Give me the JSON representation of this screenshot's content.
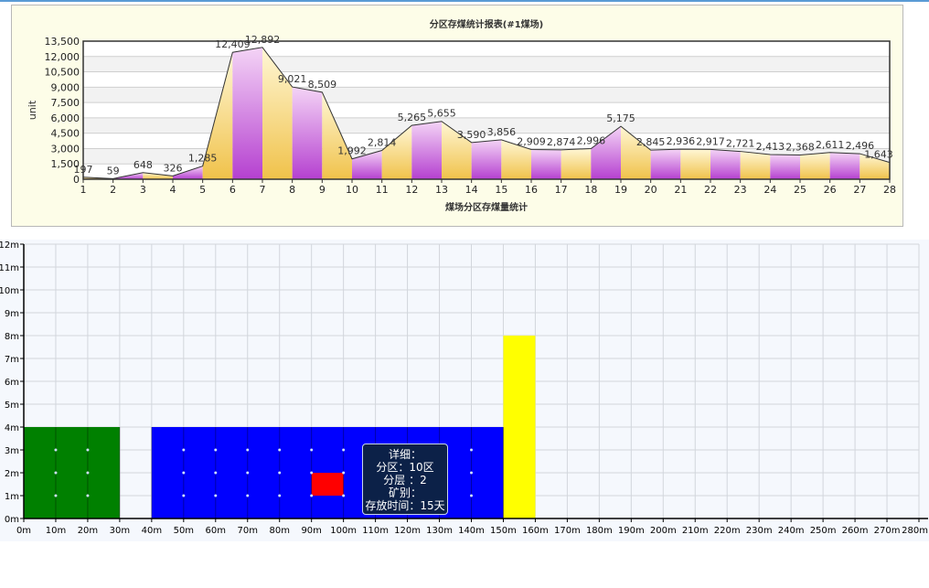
{
  "chart_data": [
    {
      "type": "area",
      "title": "分区存煤统计报表(#1煤场)",
      "xlabel": "煤场分区存煤量统计",
      "ylabel": "unit",
      "categories": [
        "1",
        "2",
        "3",
        "4",
        "5",
        "6",
        "7",
        "8",
        "9",
        "10",
        "11",
        "12",
        "13",
        "14",
        "15",
        "16",
        "17",
        "18",
        "19",
        "20",
        "21",
        "22",
        "23",
        "24",
        "25",
        "26",
        "27",
        "28"
      ],
      "values": [
        197,
        59,
        648,
        326,
        1285,
        12409,
        12892,
        9021,
        8509,
        1992,
        2814,
        5265,
        5655,
        3590,
        3856,
        2909,
        2874,
        2996,
        5175,
        2845,
        2936,
        2917,
        2721,
        2413,
        2368,
        2611,
        2496,
        1643
      ],
      "value_labels": [
        "197",
        "59",
        "648",
        "326",
        "1,285",
        "12,409",
        "12,892",
        "9,021",
        "8,509",
        "1,992",
        "2,814",
        "5,265",
        "5,655",
        "3,590",
        "3,856",
        "2,909",
        "2,874",
        "2,996",
        "5,175",
        "2,845",
        "2,936",
        "2,917",
        "2,721",
        "2,413",
        "2,368",
        "2,611",
        "2,496",
        "1,643"
      ],
      "y_ticks": [
        "0",
        "1,500",
        "3,000",
        "4,500",
        "6,000",
        "7,500",
        "9,000",
        "10,500",
        "12,000",
        "13,500"
      ],
      "ylim": [
        0,
        13500
      ],
      "grid": true,
      "colors": {
        "bar_magenta": "#c04ad8",
        "bar_gold": "#f4cb55",
        "line": "#333333"
      }
    },
    {
      "type": "bar",
      "x_ticks": [
        "0m",
        "10m",
        "20m",
        "30m",
        "40m",
        "50m",
        "60m",
        "70m",
        "80m",
        "90m",
        "100m",
        "110m",
        "120m",
        "130m",
        "140m",
        "150m",
        "160m",
        "170m",
        "180m",
        "190m",
        "200m",
        "210m",
        "220m",
        "230m",
        "240m",
        "250m",
        "260m",
        "270m",
        "280m"
      ],
      "y_ticks": [
        "0m",
        "1m",
        "2m",
        "3m",
        "4m",
        "5m",
        "6m",
        "7m",
        "8m",
        "9m",
        "10m",
        "11m",
        "12m"
      ],
      "xlim": [
        0,
        280
      ],
      "ylim": [
        0,
        12
      ],
      "grid": true,
      "blocks": [
        {
          "x0": 0,
          "x1": 30,
          "y0": 0,
          "y1": 4,
          "color": "#008000"
        },
        {
          "x0": 40,
          "x1": 150,
          "y0": 0,
          "y1": 4,
          "color": "#0000ff"
        },
        {
          "x0": 90,
          "x1": 100,
          "y0": 1,
          "y1": 2,
          "color": "#ff0000"
        },
        {
          "x0": 150,
          "x1": 160,
          "y0": 0,
          "y1": 8,
          "color": "#ffff00"
        }
      ],
      "tooltip": {
        "line1": "详细：",
        "line2": "分区：10区",
        "line3": "分层 ：2",
        "line4": "矿别：",
        "line5": "存放时间：15天"
      }
    }
  ]
}
